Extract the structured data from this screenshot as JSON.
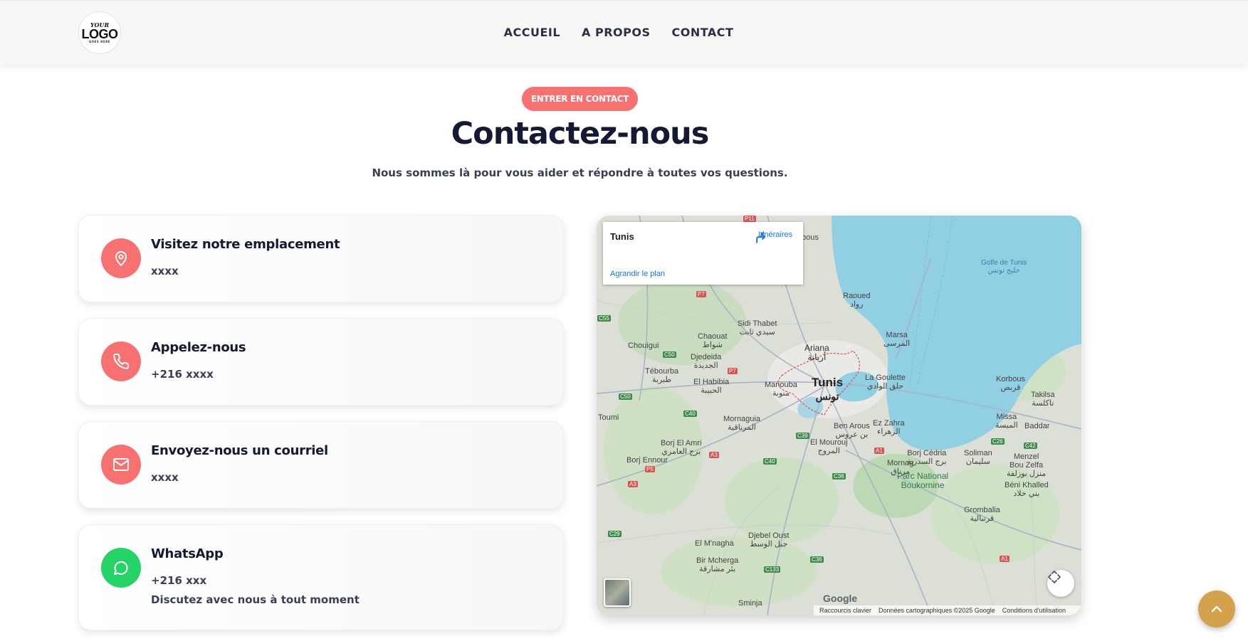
{
  "header": {
    "logo": {
      "line1": "YOUR",
      "line2": "LOGO",
      "line3": "GOES HERE"
    },
    "nav": [
      "ACCUEIL",
      "A PROPOS",
      "CONTACT"
    ]
  },
  "hero": {
    "pill": "ENTRER EN CONTACT",
    "title": "Contactez-nous",
    "subtitle": "Nous sommes là pour vous aider et répondre à toutes vos questions."
  },
  "cards": [
    {
      "icon": "location-pin-icon",
      "title": "Visitez notre emplacement",
      "value": "xxxx"
    },
    {
      "icon": "phone-icon",
      "title": "Appelez-nous",
      "value": "+216 xxxx"
    },
    {
      "icon": "mail-icon",
      "title": "Envoyez-nous un courriel",
      "value": "xxxx"
    },
    {
      "icon": "whatsapp-icon",
      "title": "WhatsApp",
      "value": "+216 xxx",
      "extra": "Discutez avec nous à tout moment"
    }
  ],
  "map": {
    "place": "Tunis",
    "directions": "Itinéraires",
    "enlarge": "Agrandir le plan",
    "labels": {
      "tunis": "Tunis",
      "tunis_ar": "تونس",
      "golfe": "Golfe de Tunis",
      "golfe_ar": "خليج تونس",
      "ariana": "Ariana",
      "ariana_ar": "أريانة",
      "raoued": "Raoued",
      "raoued_ar": "رواد",
      "marsa": "Marsa",
      "marsa_ar": "المرسى",
      "goulette": "La Goulette",
      "goulette_ar": "حلق الوادي",
      "sidi_thabet": "Sidi Thabet",
      "sidi_thabet_ar": "سيدي ثابت",
      "chaouat": "Chaouat",
      "chaouat_ar": "شواط",
      "chouigui": "Chouigui",
      "djedeida": "Djedeida",
      "djedeida_ar": "الجديدة",
      "tebourba": "Tébourba",
      "tebourba_ar": "طبربة",
      "el_habibia": "El Habibia",
      "el_habibia_ar": "الحبيبة",
      "manouba": "Manouba",
      "manouba_ar": "منوبة",
      "mornaguia": "Mornaguia",
      "mornaguia_ar": "المرناقية",
      "toumi": "Toumi",
      "borj_el_amri": "Borj El Amri",
      "borj_el_amri_ar": "برج العامري",
      "borj_ennour": "Borj Ennour",
      "ben_arous": "Ben Arous",
      "ben_arous_ar": "بن عروس",
      "ez_zahra": "Ez Zahra",
      "ez_zahra_ar": "الزهراء",
      "el_mourouj": "El Mourouj",
      "el_mourouj_ar": "المروج",
      "mornag": "Mornag",
      "mornag_ar": "مرناق",
      "borj_cedria": "Borj Cédria",
      "borj_cedria_ar": "برج السدرية",
      "soliman": "Soliman",
      "soliman_ar": "سليمان",
      "korbous": "Korbous",
      "korbous_ar": "قربص",
      "takilsa": "Takilsa",
      "takilsa_ar": "تاكلسة",
      "missa": "Missa",
      "missa_ar": "الميسة",
      "baddar": "Baddar",
      "menzel": "Menzel",
      "bou_zelfa": "Bou Zelfa",
      "bou_zelfa_ar": "منزل بوزلفة",
      "beni_khalled": "Béni Khalled",
      "beni_khalled_ar": "بني خلاد",
      "parc": "Parc National",
      "boukornine": "Boukornine",
      "grombalia": "Grombalia",
      "grombalia_ar": "قرنبالية",
      "djebel_oust": "Djebel Oust",
      "djebel_oust_ar": "جبل الوسط",
      "el_mnagha": "El M'nagha",
      "bir_mcherga": "Bir Mcherga",
      "bir_mcherga_ar": "بئر مشارقة",
      "sminja": "Sminja",
      "bous": "bous"
    },
    "roads": {
      "p7a": "P7",
      "c55": "C55",
      "c50a": "C50",
      "p7b": "P7",
      "c50b": "C50",
      "c40a": "C40",
      "c39": "C39",
      "a3a": "A3",
      "p5": "P5",
      "a3b": "A3",
      "c40b": "C40",
      "a1a": "A1",
      "c36a": "C36",
      "c26": "C26",
      "c42": "C42",
      "c29": "C29",
      "c133": "C133",
      "c36b": "C36",
      "a1b": "A1",
      "red_top": "P11"
    },
    "google": "Google",
    "footer": [
      "Raccourcis clavier",
      "Données cartographiques ©2025 Google",
      "Conditions d'utilisation"
    ]
  },
  "colors": {
    "accent": "#f77171",
    "whatsapp": "#25d366",
    "to_top": "#d4a24c",
    "title": "#141a33"
  }
}
